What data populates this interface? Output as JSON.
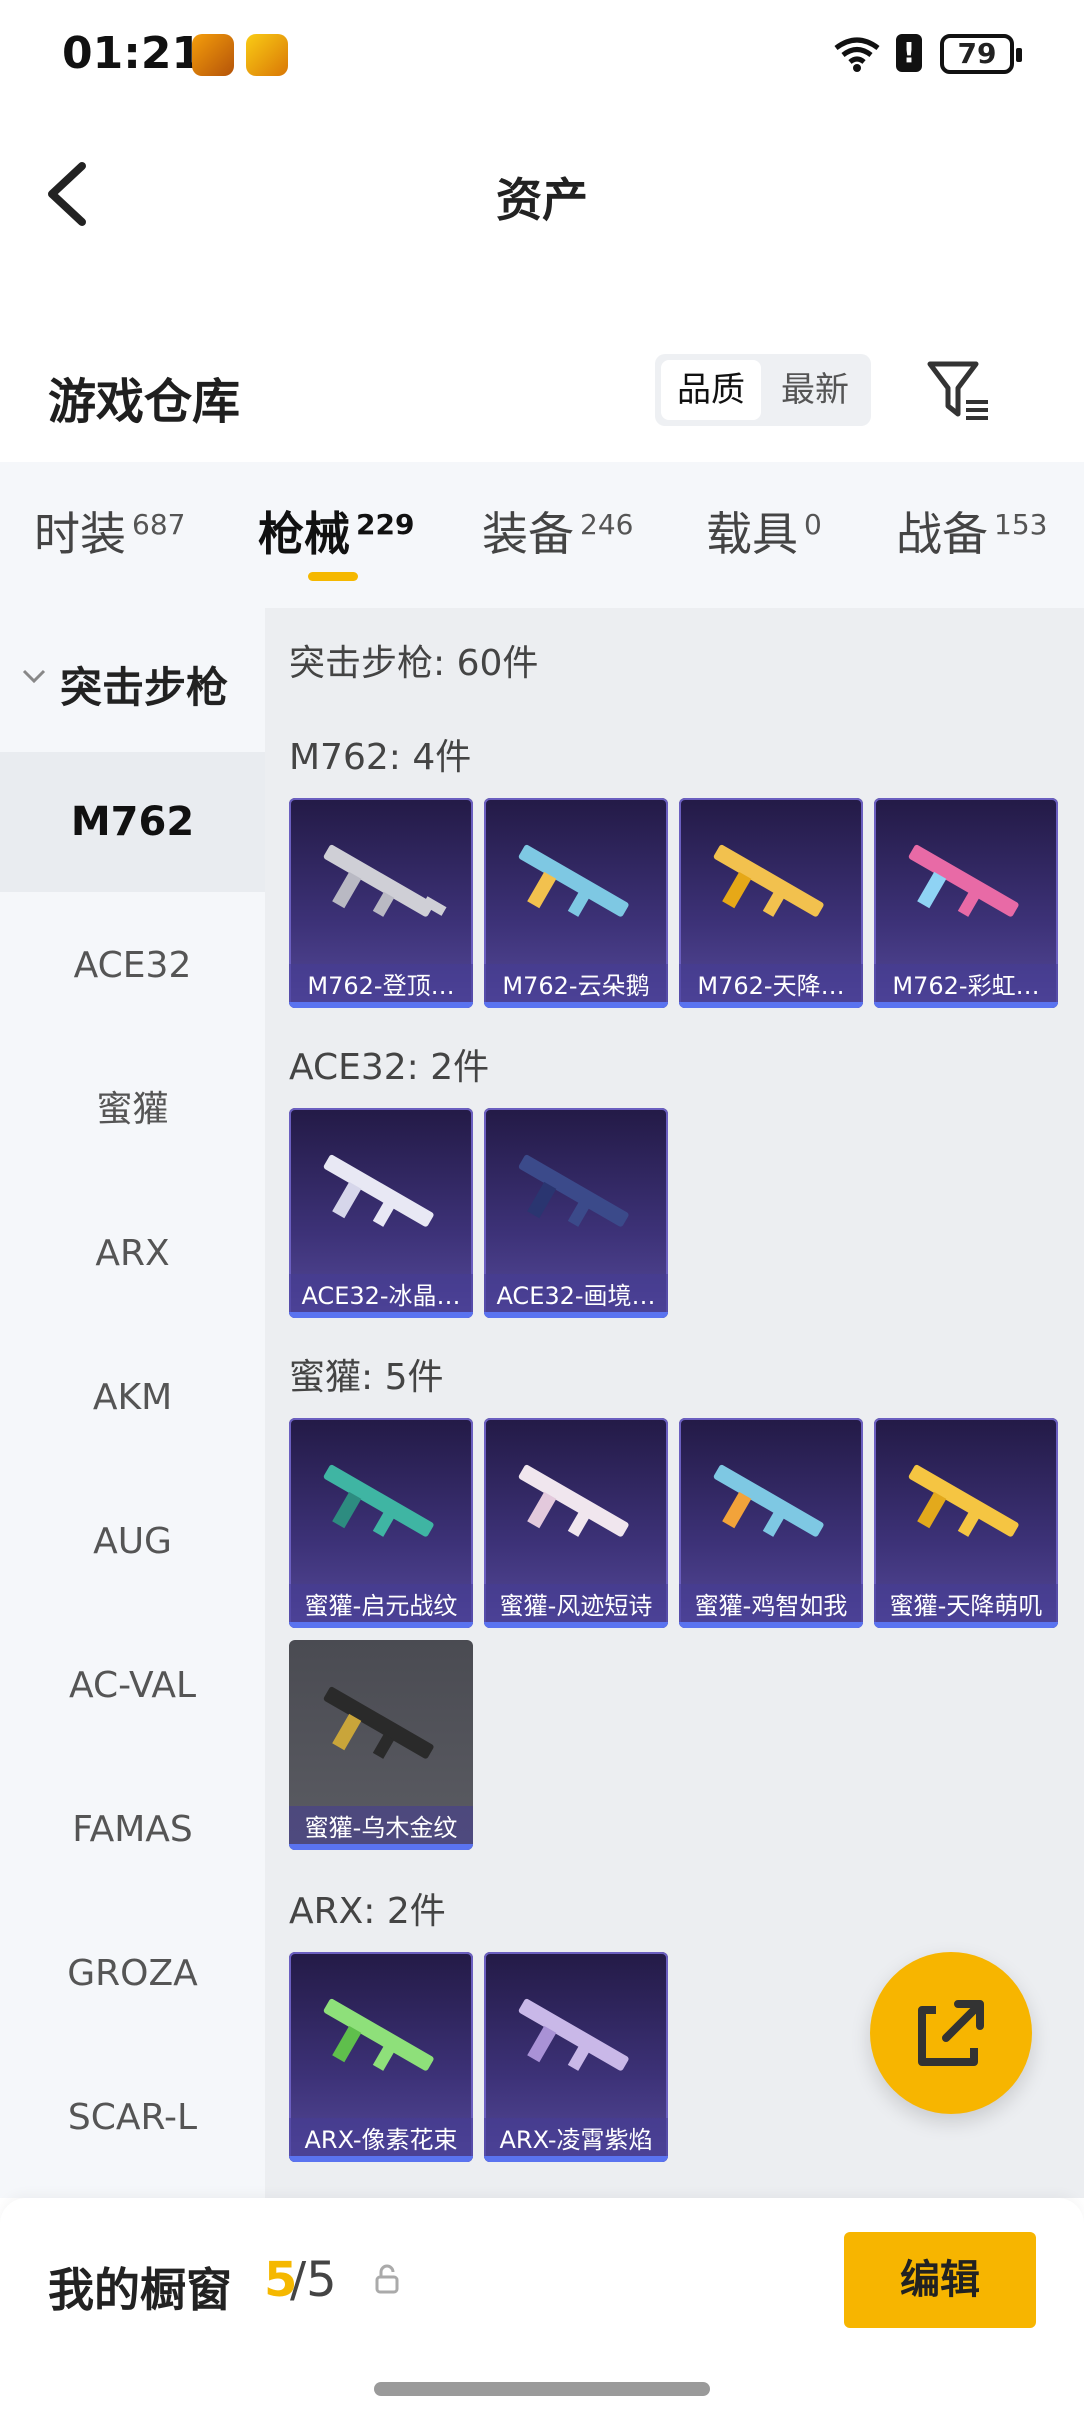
{
  "status": {
    "time": "01:21",
    "battery": "79"
  },
  "header": {
    "title": "资产"
  },
  "warehouse": {
    "label": "游戏仓库",
    "sort_quality": "品质",
    "sort_newest": "最新"
  },
  "tabs": [
    {
      "label": "时装",
      "count": "687"
    },
    {
      "label": "枪械",
      "count": "229"
    },
    {
      "label": "装备",
      "count": "246"
    },
    {
      "label": "载具",
      "count": "0"
    },
    {
      "label": "战备",
      "count": "153"
    }
  ],
  "sidebar": {
    "group": "突击步枪",
    "items": [
      "M762",
      "ACE32",
      "蜜獾",
      "ARX",
      "AKM",
      "AUG",
      "AC-VAL",
      "FAMAS",
      "GROZA",
      "SCAR-L"
    ]
  },
  "content": {
    "total": "突击步枪: 60件",
    "sections": [
      {
        "title": "M762: 4件",
        "items": [
          "M762-登顶…",
          "M762-云朵鹅",
          "M762-天降…",
          "M762-彩虹…"
        ]
      },
      {
        "title": "ACE32: 2件",
        "items": [
          "ACE32-冰晶…",
          "ACE32-画境…"
        ]
      },
      {
        "title": "蜜獾: 5件",
        "items": [
          "蜜獾-启元战纹",
          "蜜獾-风迹短诗",
          "蜜獾-鸡智如我",
          "蜜獾-天降萌叽",
          "蜜獾-乌木金纹"
        ]
      },
      {
        "title": "ARX: 2件",
        "items": [
          "ARX-像素花束",
          "ARX-凌霄紫焰"
        ]
      }
    ]
  },
  "bottom": {
    "label": "我的橱窗",
    "count_current": "5",
    "count_total": "/5",
    "edit_label": "编辑"
  }
}
